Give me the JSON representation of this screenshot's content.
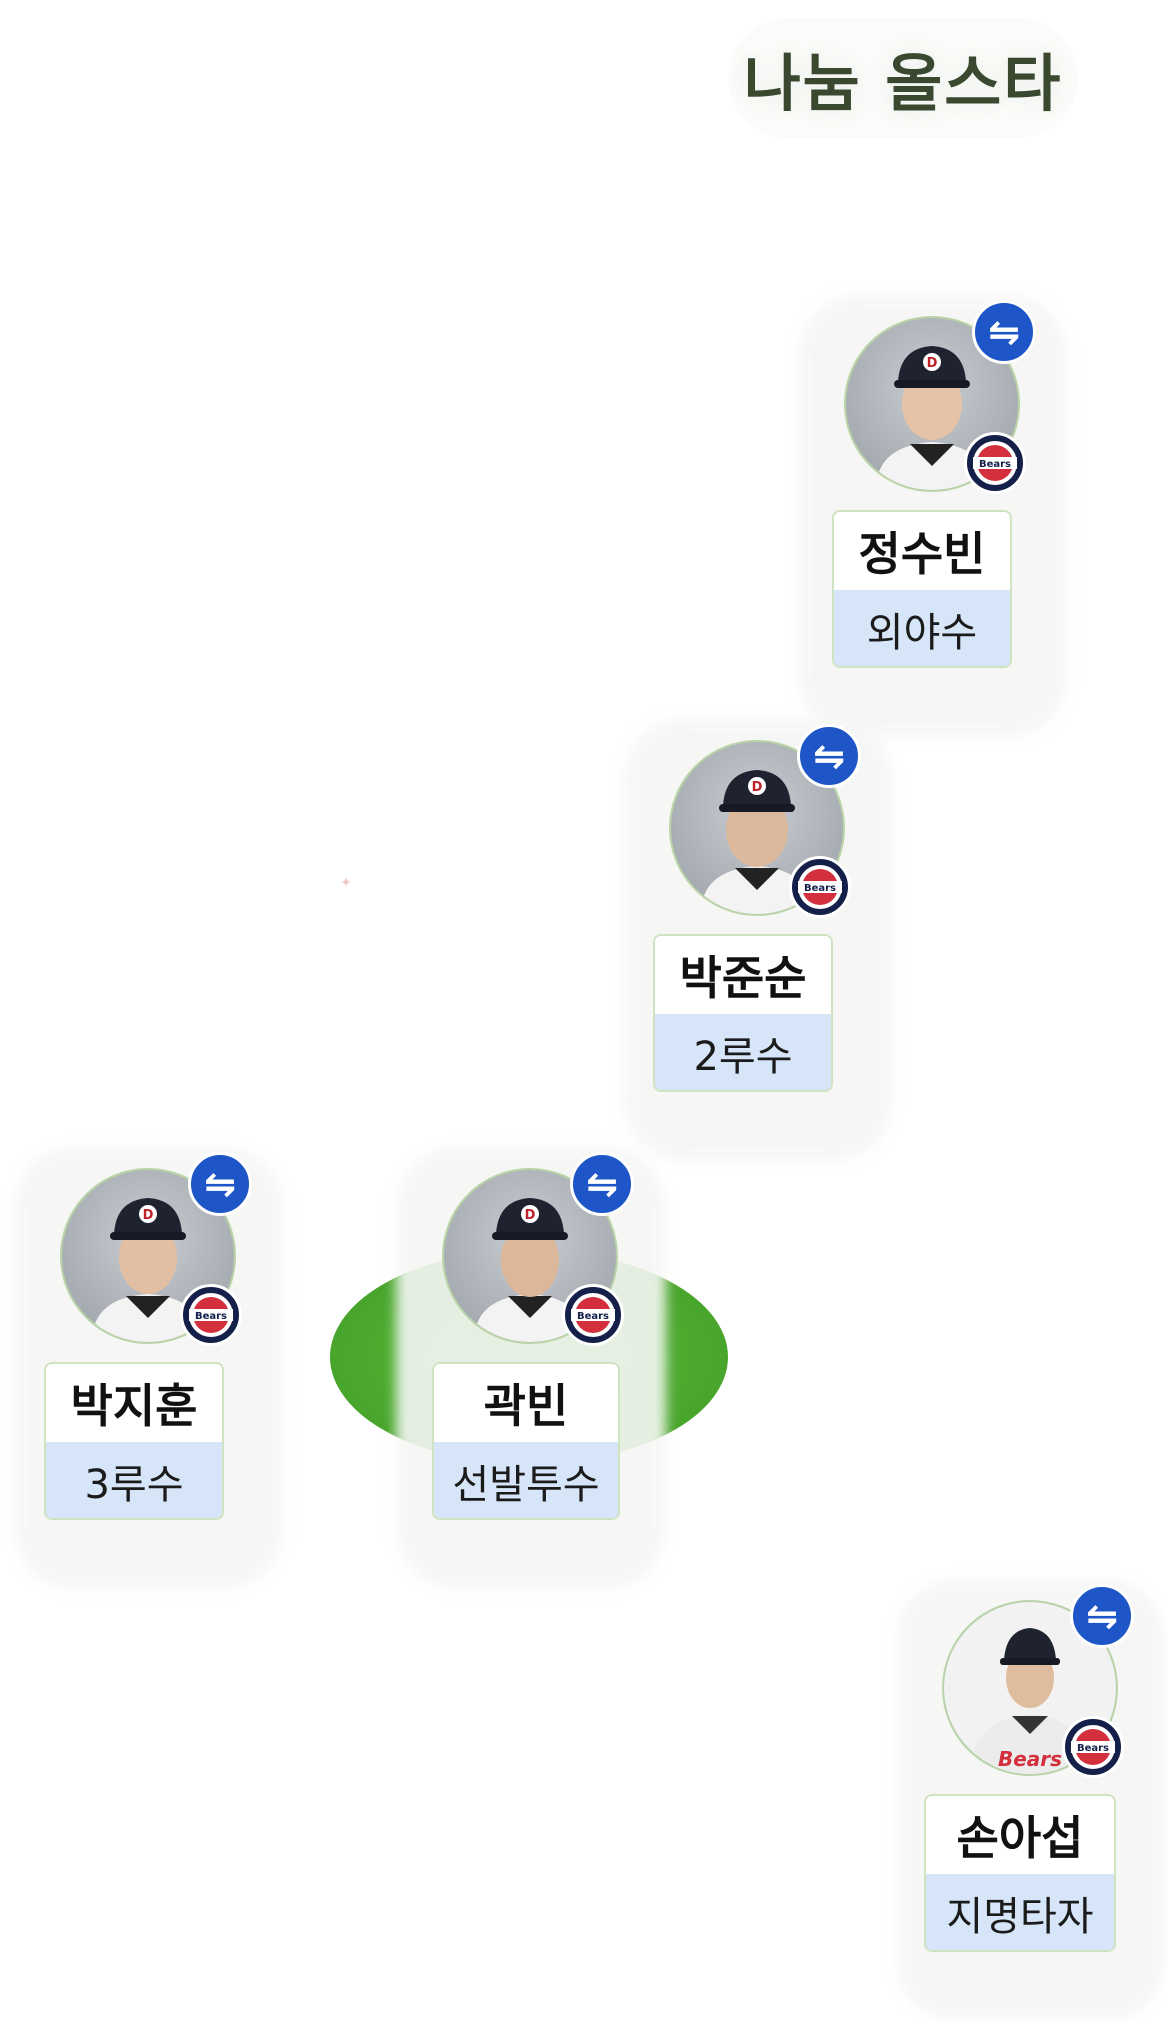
{
  "header": {
    "title": "나눔 올스타"
  },
  "players": [
    {
      "name": "정수빈",
      "position": "외야수"
    },
    {
      "name": "박준순",
      "position": "2루수"
    },
    {
      "name": "박지훈",
      "position": "3루수"
    },
    {
      "name": "곽빈",
      "position": "선발투수"
    },
    {
      "name": "손아섭",
      "position": "지명타자"
    }
  ],
  "icons": {
    "swap": "swap-arrows-icon",
    "team": "bears-team-logo"
  },
  "colors": {
    "swap_badge": "#1e56c8",
    "position_bg": "#d6e6f8",
    "mound": "#4aa72d",
    "title": "#39482f"
  }
}
